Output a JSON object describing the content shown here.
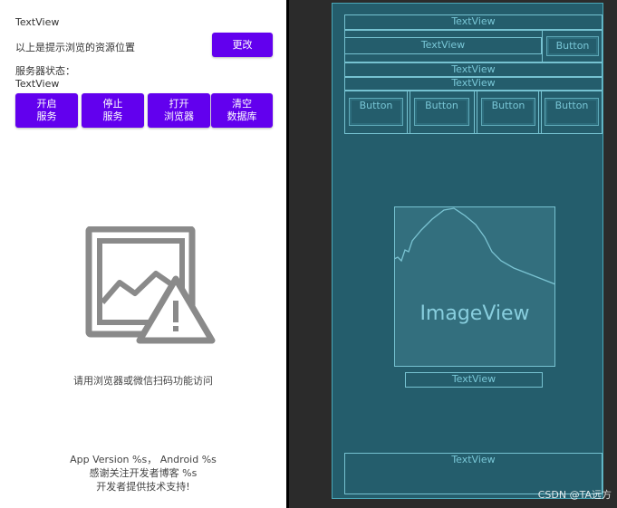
{
  "app": {
    "textview_top": "TextView",
    "resource_hint": "以上是提示浏览的资源位置",
    "change_button": "更改",
    "server_status_label": "服务器状态：",
    "textview_status": "TextView",
    "buttons": [
      {
        "label": "开启\n服务"
      },
      {
        "label": "停止\n服务"
      },
      {
        "label": "打开\n浏览器"
      },
      {
        "label": "清空\n数据库"
      }
    ],
    "scan_hint": "请用浏览器或微信扫码功能访问",
    "footer_lines": [
      "App Version %s， Android %s",
      "感谢关注开发者博客 %s",
      "开发者提供技术支持!"
    ]
  },
  "blueprint": {
    "textview_1": "TextView",
    "textview_2": "TextView",
    "button_1": "Button",
    "textview_3": "TextView",
    "textview_4": "TextView",
    "row_buttons": [
      "Button",
      "Button",
      "Button",
      "Button"
    ],
    "imageview": "ImageView",
    "textview_5": "TextView",
    "textview_6": "TextView"
  },
  "watermark": "CSDN @TA远方",
  "colors": {
    "accent": "#6200ee",
    "blueprint_bg": "#245d6c",
    "blueprint_line": "#76c2d1"
  }
}
